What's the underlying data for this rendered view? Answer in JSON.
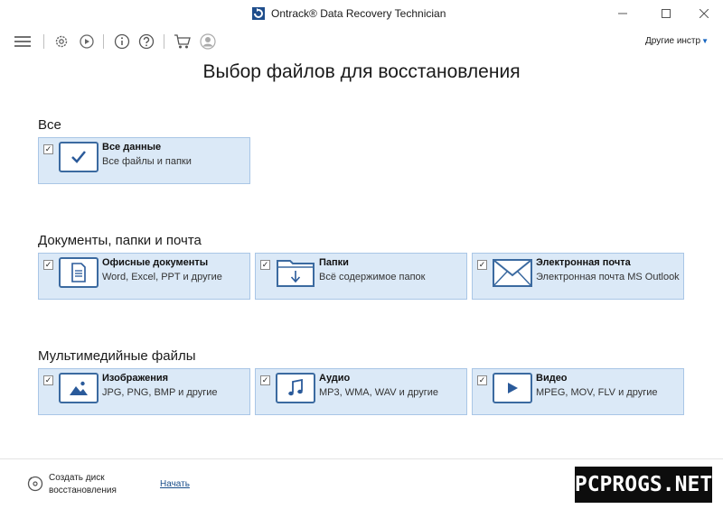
{
  "window": {
    "title": "Ontrack® Data Recovery Technician"
  },
  "toolbar": {
    "other_tools_label": "Другие инстр",
    "icons": [
      "menu-icon",
      "gear-icon",
      "recovery-icon",
      "info-icon",
      "help-icon",
      "cart-icon",
      "user-icon"
    ]
  },
  "main": {
    "headline": "Выбор файлов для восстановления",
    "sections": [
      {
        "title": "Все",
        "cards": [
          {
            "title": "Все данные",
            "subtitle": "Все файлы и папки",
            "checked": true,
            "icon": "checkmark-icon"
          }
        ]
      },
      {
        "title": "Документы, папки и почта",
        "cards": [
          {
            "title": "Офисные документы",
            "subtitle": "Word, Excel, PPT и другие",
            "checked": true,
            "icon": "document-icon"
          },
          {
            "title": "Папки",
            "subtitle": "Всё содержимое папок",
            "checked": true,
            "icon": "folder-icon"
          },
          {
            "title": "Электронная почта",
            "subtitle": "Электронная почта MS Outlook",
            "checked": true,
            "icon": "envelope-icon"
          }
        ]
      },
      {
        "title": "Мультимедийные файлы",
        "cards": [
          {
            "title": "Изображения",
            "subtitle": "JPG, PNG, BMP и другие",
            "checked": true,
            "icon": "image-icon"
          },
          {
            "title": "Аудио",
            "subtitle": "MP3, WMA, WAV и другие",
            "checked": true,
            "icon": "music-note-icon"
          },
          {
            "title": "Видео",
            "subtitle": "MPEG, MOV, FLV и другие",
            "checked": true,
            "icon": "play-icon"
          }
        ]
      }
    ]
  },
  "footer": {
    "create_disk_label": "Создать диск восстановления",
    "start_label": "Начать",
    "watermark": "PCPROGS.NET"
  },
  "colors": {
    "card_bg": "#dbe9f7",
    "card_border": "#a9c6e6",
    "icon_blue": "#3b6aa0",
    "link": "#1a4f8b"
  }
}
